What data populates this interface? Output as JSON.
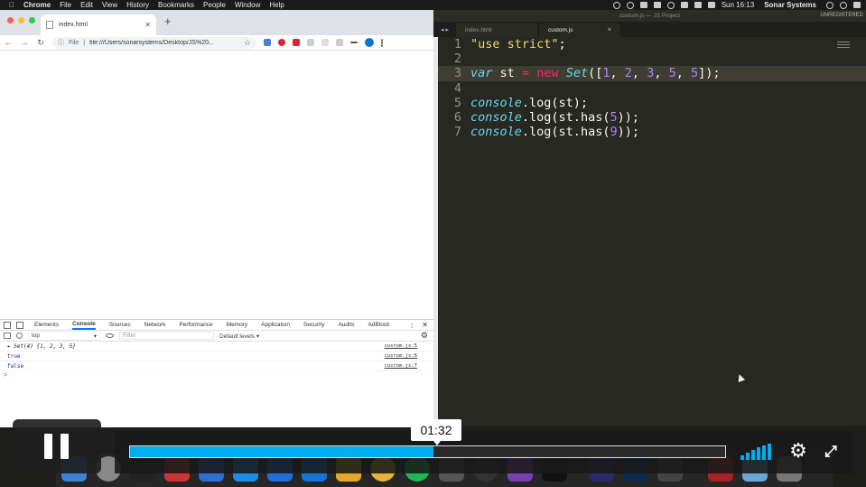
{
  "menubar": {
    "app": "Chrome",
    "items": [
      "File",
      "Edit",
      "View",
      "History",
      "Bookmarks",
      "People",
      "Window",
      "Help"
    ],
    "clock": "Sun 16:13",
    "user": "Sonar Systems"
  },
  "chrome": {
    "tab_title": "index.html",
    "address_label": "File",
    "url": "file:///Users/sonarsystems/Desktop/JS%20..."
  },
  "devtools": {
    "tabs": [
      "Elements",
      "Console",
      "Sources",
      "Network",
      "Performance",
      "Memory",
      "Application",
      "Security",
      "Audits",
      "AdBlock"
    ],
    "active_tab": "Console",
    "context": "top",
    "filter_placeholder": "Filter",
    "levels": "Default levels ▾",
    "logs": [
      {
        "text": "▸ Set(4) {1, 2, 3, 5}",
        "source": "custom.js:5"
      },
      {
        "text": "true",
        "source": "custom.js:6"
      },
      {
        "text": "false",
        "source": "custom.js:7"
      }
    ],
    "prompt": ">"
  },
  "sublime": {
    "window_title": "custom.js — JS Project",
    "registration": "UNREGISTERED",
    "tabs": [
      {
        "label": "index.html"
      },
      {
        "label": "custom.js",
        "close": "×"
      }
    ],
    "line_numbers": [
      "1",
      "2",
      "3",
      "4",
      "5",
      "6",
      "7"
    ],
    "code": {
      "l1": "\"use strict\"",
      "l1_end": ";",
      "l3_kw": "var",
      "l3_var": " st ",
      "l3_eq": "=",
      "l3_new": "new",
      "l3_set": "Set",
      "l3_open": "([",
      "n1": "1",
      "n2": "2",
      "n3": "3",
      "n5a": "5",
      "n5b": "5",
      "comma": ", ",
      "l3_close": "]);",
      "console": "console",
      "log_st": ".log(st);",
      "log_has_pre": ".log(st.",
      "has": "has",
      "p5": "(",
      "v5": "5",
      "close5": "));",
      "v9": "9"
    }
  },
  "video": {
    "time": "01:32",
    "progress_percent": 51
  }
}
